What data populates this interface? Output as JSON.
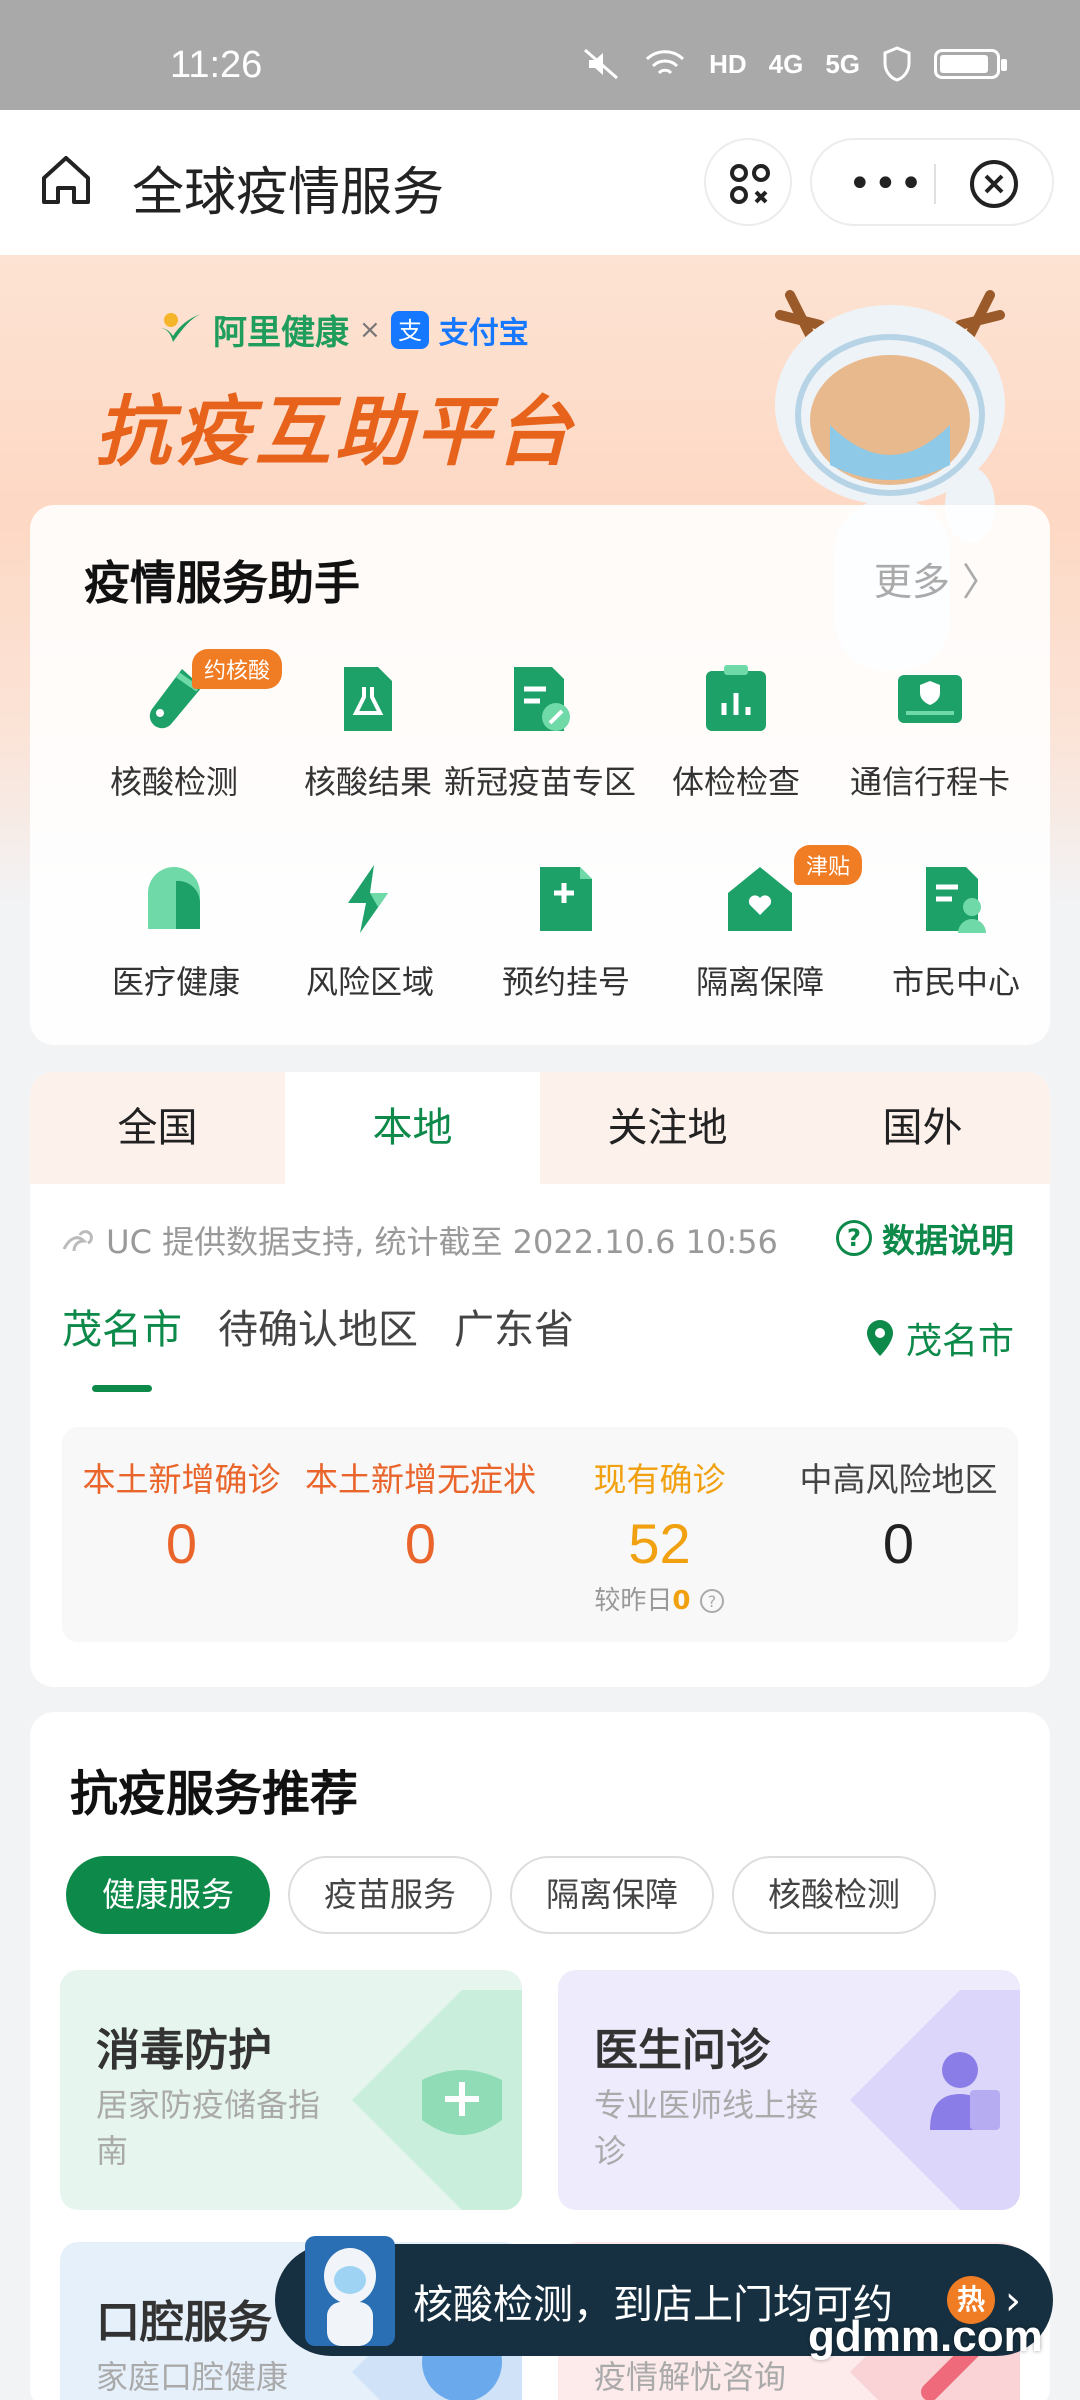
{
  "status_bar": {
    "time": "11:26",
    "net": "HD",
    "sig1": "4G",
    "sig2": "5G"
  },
  "title_bar": {
    "title": "全球疫情服务"
  },
  "banner": {
    "brand_ali": "阿里健康",
    "brand_sep": "×",
    "brand_zfb": "支付宝",
    "title": "抗疫互助平台"
  },
  "services": {
    "title": "疫情服务助手",
    "more": "更多 〉",
    "items": [
      {
        "label": "核酸检测",
        "tag": "约核酸",
        "icon": "test-tube-icon"
      },
      {
        "label": "核酸结果",
        "icon": "flask-doc-icon"
      },
      {
        "label": "新冠疫苗专区",
        "icon": "vaccine-doc-icon"
      },
      {
        "label": "体检检查",
        "icon": "clipboard-chart-icon"
      },
      {
        "label": "通信行程卡",
        "icon": "shield-card-icon"
      },
      {
        "label": "医疗健康",
        "icon": "heart-chat-icon"
      },
      {
        "label": "风险区域",
        "icon": "lightning-icon"
      },
      {
        "label": "预约挂号",
        "icon": "plus-doc-icon"
      },
      {
        "label": "隔离保障",
        "tag": "津贴",
        "icon": "house-heart-icon"
      },
      {
        "label": "市民中心",
        "icon": "person-doc-icon"
      }
    ]
  },
  "data_card": {
    "tabs": [
      "全国",
      "本地",
      "关注地",
      "国外"
    ],
    "active_tab": 1,
    "source": "UC 提供数据支持, 统计截至 2022.10.6 10:56",
    "explain": "数据说明",
    "regions": [
      "茂名市",
      "待确认地区",
      "广东省"
    ],
    "location": "茂名市",
    "stats": [
      {
        "label": "本土新增确诊",
        "value": "0",
        "color": "#e9652b"
      },
      {
        "label": "本土新增无症状",
        "value": "0",
        "color": "#e9652b"
      },
      {
        "label": "现有确诊",
        "value": "52",
        "color": "#f1a10f",
        "sub_prefix": "较昨日",
        "sub_value": "0"
      },
      {
        "label": "中高风险地区",
        "value": "0",
        "color": "#222222"
      }
    ]
  },
  "recommend": {
    "title": "抗疫服务推荐",
    "chips": [
      "健康服务",
      "疫苗服务",
      "隔离保障",
      "核酸检测"
    ],
    "tiles": [
      {
        "title": "消毒防护",
        "desc": "居家防疫储备指南"
      },
      {
        "title": "医生问诊",
        "desc": "专业医师线上接诊"
      },
      {
        "title": "口腔服务",
        "desc": "家庭口腔健康"
      },
      {
        "title": "",
        "desc": "疫情解忧咨询"
      }
    ]
  },
  "float_bar": {
    "text": "核酸检测，到店上门均可约",
    "hot": "热"
  },
  "watermark": "gdmm.com",
  "colors": {
    "brand_green": "#0d8a4a",
    "orange": "#e9652b",
    "amber": "#f1a10f"
  }
}
